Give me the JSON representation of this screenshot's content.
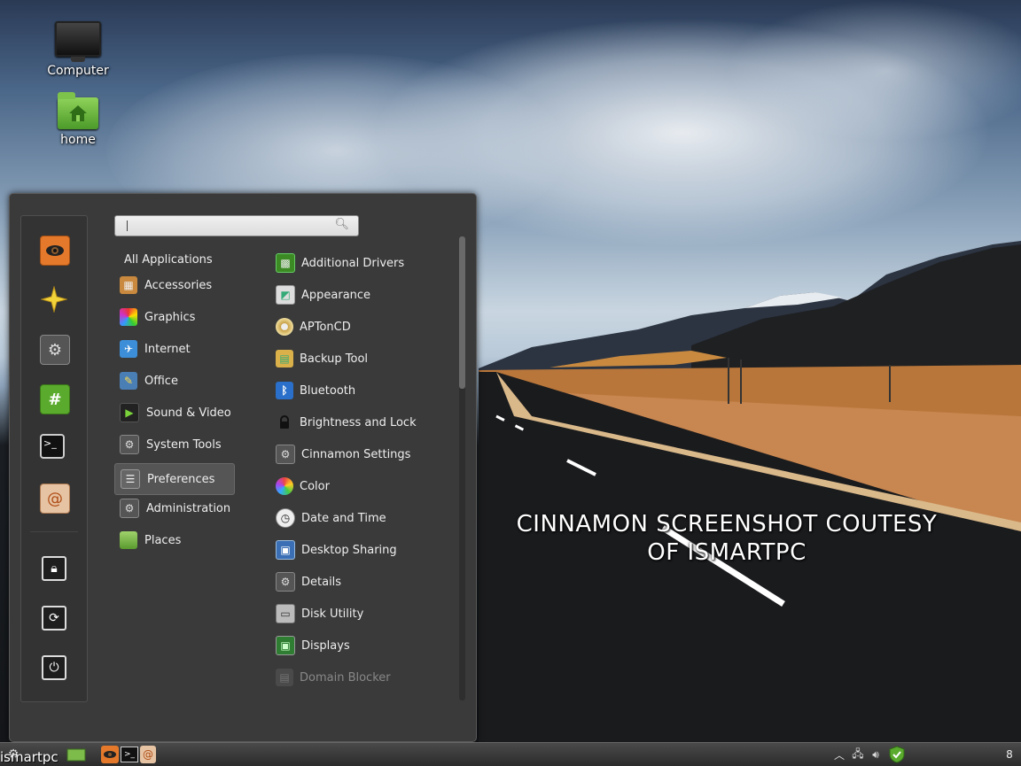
{
  "desktop": {
    "icons": [
      {
        "label": "Computer",
        "icon": "monitor-icon"
      },
      {
        "label": "home",
        "icon": "home-folder-icon"
      }
    ],
    "overlay_text_line1": "CINNAMON SCREENSHOT COUTESY",
    "overlay_text_line2": "OF ISMARTPC"
  },
  "menu": {
    "search": {
      "value": "",
      "placeholder": ""
    },
    "favorites": [
      {
        "name": "eye-app-icon",
        "color": "#e4792b"
      },
      {
        "name": "star-icon",
        "color": "#f2d33a"
      },
      {
        "name": "settings-gear-icon",
        "color": "#777777"
      },
      {
        "name": "terminal-hash-icon",
        "color": "#5aab2d"
      },
      {
        "name": "terminal-icon",
        "color": "#222222"
      },
      {
        "name": "shell-app-icon",
        "color": "#d98a4c"
      }
    ],
    "session": [
      {
        "name": "lock-icon"
      },
      {
        "name": "logout-icon"
      },
      {
        "name": "power-icon"
      }
    ],
    "categories": [
      {
        "label": "All Applications"
      },
      {
        "label": "Accessories",
        "icon": "accessories-icon"
      },
      {
        "label": "Graphics",
        "icon": "graphics-icon"
      },
      {
        "label": "Internet",
        "icon": "internet-icon"
      },
      {
        "label": "Office",
        "icon": "office-icon"
      },
      {
        "label": "Sound & Video",
        "icon": "sound-video-icon"
      },
      {
        "label": "System Tools",
        "icon": "system-tools-icon"
      },
      {
        "label": "Preferences",
        "icon": "preferences-icon",
        "selected": true
      },
      {
        "label": "Administration",
        "icon": "administration-icon"
      },
      {
        "label": "Places",
        "icon": "places-folder-icon"
      }
    ],
    "apps": [
      {
        "label": "Additional Drivers",
        "icon": "chip-icon"
      },
      {
        "label": "Appearance",
        "icon": "appearance-icon"
      },
      {
        "label": "APTonCD",
        "icon": "cd-icon"
      },
      {
        "label": "Backup Tool",
        "icon": "backup-icon"
      },
      {
        "label": "Bluetooth",
        "icon": "bluetooth-icon"
      },
      {
        "label": "Brightness and Lock",
        "icon": "lock-small-icon"
      },
      {
        "label": "Cinnamon Settings",
        "icon": "cinnamon-settings-icon"
      },
      {
        "label": "Color",
        "icon": "color-icon"
      },
      {
        "label": "Date and Time",
        "icon": "clock-icon"
      },
      {
        "label": "Desktop Sharing",
        "icon": "desktop-sharing-icon"
      },
      {
        "label": "Details",
        "icon": "details-icon"
      },
      {
        "label": "Disk Utility",
        "icon": "disk-icon"
      },
      {
        "label": "Displays",
        "icon": "displays-icon"
      },
      {
        "label": "Domain Blocker",
        "icon": "domain-blocker-icon",
        "dim": true
      }
    ]
  },
  "taskbar": {
    "watermark": "ismartpc",
    "workspace": "8"
  }
}
